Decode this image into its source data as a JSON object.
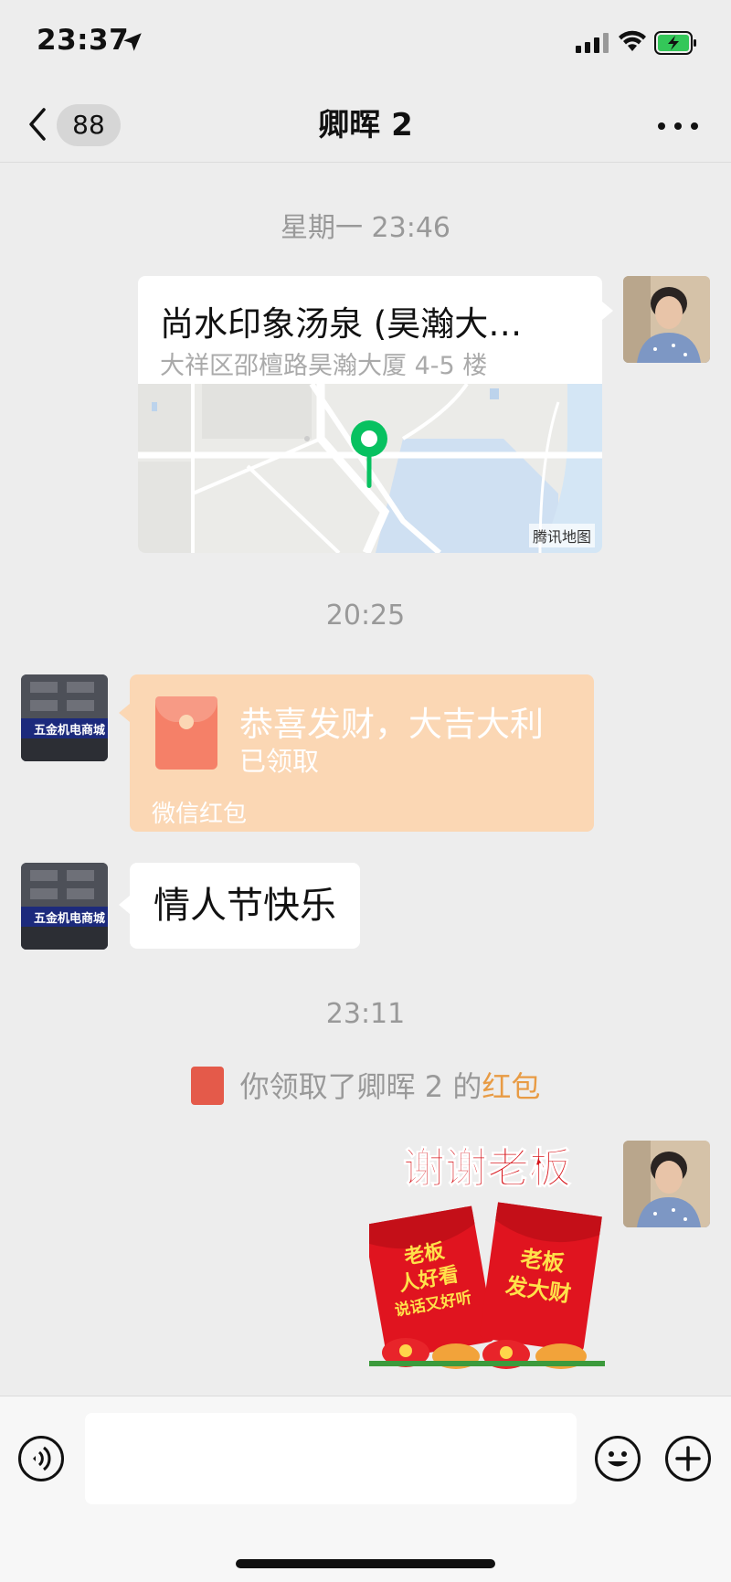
{
  "status_bar": {
    "time": "23:37",
    "battery": "charging"
  },
  "nav": {
    "unread_count": "88",
    "title": "卿晖 2"
  },
  "messages": {
    "time_1": "星期一 23:46",
    "location": {
      "title": "尚水印象汤泉 (昊瀚大…",
      "address": "大祥区邵檀路昊瀚大厦 4-5 楼",
      "map_brand": "腾讯地图"
    },
    "time_2": "20:25",
    "red_packet": {
      "greeting": "恭喜发财，大吉大利",
      "status": "已领取",
      "footer": "微信红包"
    },
    "text_message": "情人节快乐",
    "time_3": "23:11",
    "system_notice": {
      "prefix": "你领取了卿晖 2 的",
      "link": "红包"
    },
    "sticker": {
      "top_text": "谢谢老板",
      "envelope_left": [
        "老板",
        "人好看",
        "说话又好听"
      ],
      "envelope_right": [
        "老板",
        "发大财"
      ]
    }
  },
  "input": {
    "placeholder": ""
  },
  "colors": {
    "background": "#ededed",
    "red_packet_received": "#fbd7b4",
    "link_orange": "#e89b44",
    "map_pin": "#07c160"
  },
  "icons": [
    "location-arrow-icon",
    "signal-icon",
    "wifi-icon",
    "battery-charging-icon",
    "back-chevron-icon",
    "more-icon",
    "map-pin-icon",
    "red-packet-icon",
    "voice-icon",
    "emoji-icon",
    "plus-icon"
  ]
}
